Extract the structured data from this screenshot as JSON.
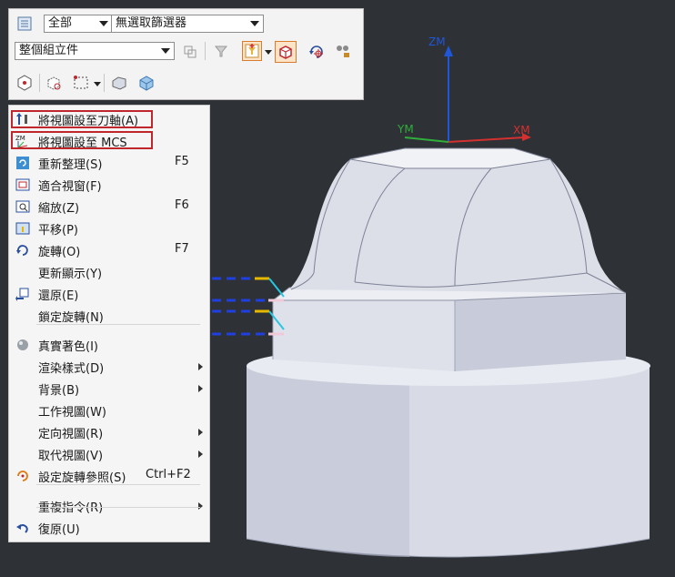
{
  "toolbar": {
    "filter_combo": "全部",
    "selector_combo": "無選取篩選器",
    "scope_combo": "整個組立件"
  },
  "axes": {
    "zm": "ZM",
    "ym": "YM",
    "xm": "XM"
  },
  "menu": {
    "items": [
      {
        "label": "將視圖設至刀軸(A)",
        "shortcut": "",
        "submenu": false,
        "icon": "tool-axis-view-icon"
      },
      {
        "label": "將視圖設至 MCS",
        "shortcut": "",
        "submenu": false,
        "icon": "mcs-view-icon"
      },
      {
        "label": "重新整理(S)",
        "shortcut": "F5",
        "submenu": false,
        "icon": "refresh-icon"
      },
      {
        "label": "適合視窗(F)",
        "shortcut": "",
        "submenu": false,
        "icon": "fit-window-icon"
      },
      {
        "label": "縮放(Z)",
        "shortcut": "F6",
        "submenu": false,
        "icon": "zoom-icon"
      },
      {
        "label": "平移(P)",
        "shortcut": "",
        "submenu": false,
        "icon": "pan-icon"
      },
      {
        "label": "旋轉(O)",
        "shortcut": "F7",
        "submenu": false,
        "icon": "rotate-icon"
      },
      {
        "label": "更新顯示(Y)",
        "shortcut": "",
        "submenu": false,
        "icon": ""
      },
      {
        "label": "還原(E)",
        "shortcut": "",
        "submenu": false,
        "icon": "restore-icon"
      },
      {
        "label": "鎖定旋轉(N)",
        "shortcut": "",
        "submenu": false,
        "icon": ""
      },
      {
        "label": "真實著色(I)",
        "shortcut": "",
        "submenu": false,
        "icon": "true-shading-icon"
      },
      {
        "label": "渲染樣式(D)",
        "shortcut": "",
        "submenu": true,
        "icon": ""
      },
      {
        "label": "背景(B)",
        "shortcut": "",
        "submenu": true,
        "icon": ""
      },
      {
        "label": "工作視圖(W)",
        "shortcut": "",
        "submenu": false,
        "icon": ""
      },
      {
        "label": "定向視圖(R)",
        "shortcut": "",
        "submenu": true,
        "icon": ""
      },
      {
        "label": "取代視圖(V)",
        "shortcut": "",
        "submenu": true,
        "icon": ""
      },
      {
        "label": "設定旋轉參照(S)",
        "shortcut": "Ctrl+F2",
        "submenu": false,
        "icon": "rotate-reference-icon"
      },
      {
        "label": "重複指令(R)",
        "shortcut": "",
        "submenu": true,
        "icon": ""
      },
      {
        "label": "復原(U)",
        "shortcut": "",
        "submenu": false,
        "icon": "undo-icon"
      }
    ]
  },
  "colors": {
    "background": "#2e3136",
    "highlight_border": "#c0272d",
    "axis_z": "#2056d8",
    "axis_y": "#2fae3a",
    "axis_x": "#d43030"
  }
}
